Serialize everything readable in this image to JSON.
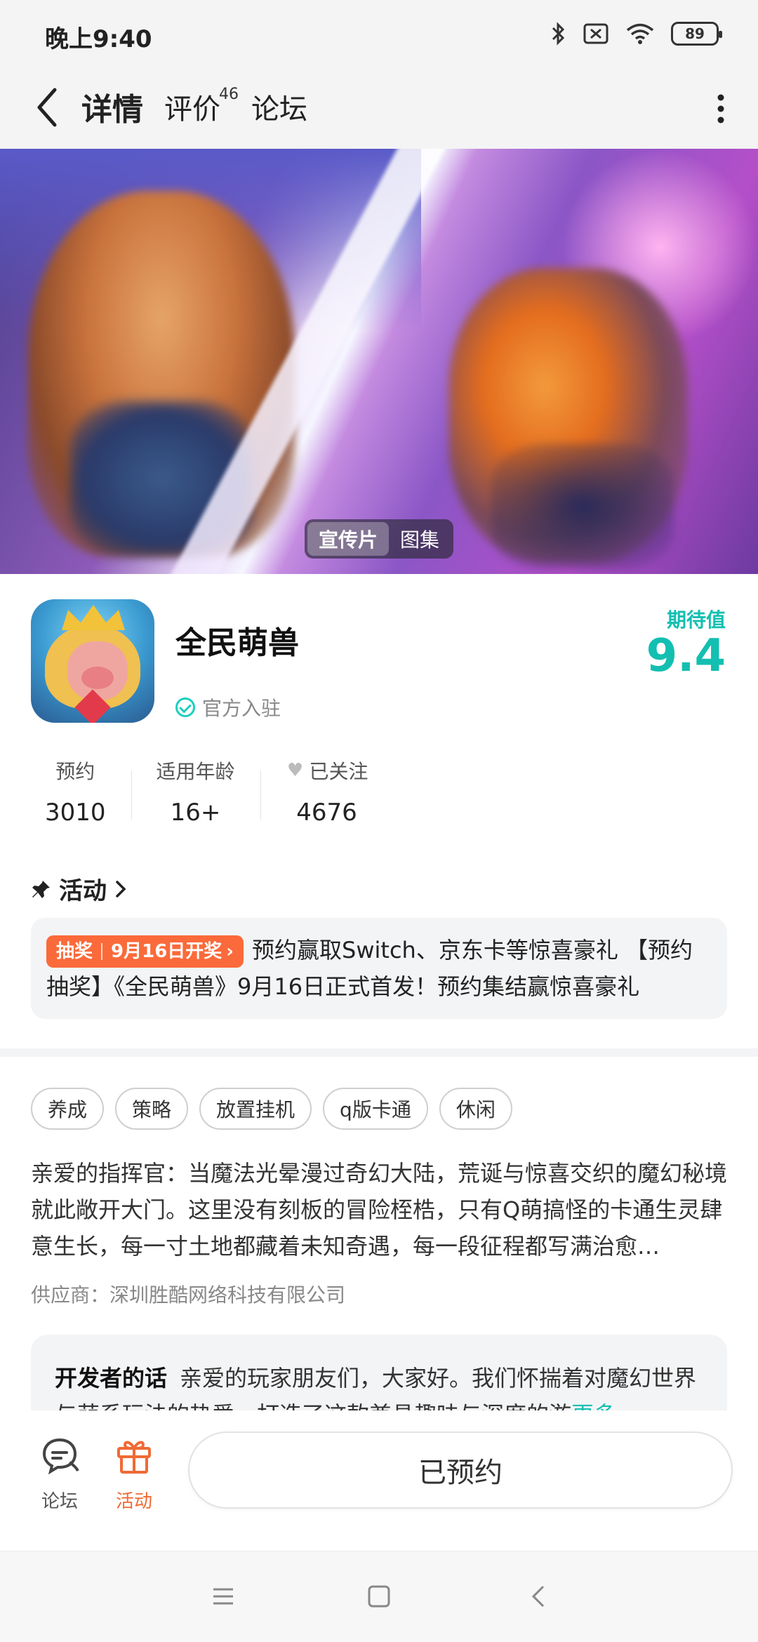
{
  "status_bar": {
    "time": "晚上9:40",
    "battery": "89"
  },
  "header": {
    "tabs": [
      {
        "label": "详情",
        "active": true
      },
      {
        "label": "评价",
        "count": "46"
      },
      {
        "label": "论坛"
      }
    ]
  },
  "banner": {
    "segments": [
      "宣传片",
      "图集"
    ],
    "selected": "宣传片"
  },
  "app": {
    "name": "全民萌兽",
    "official_label": "官方入驻",
    "expect_label": "期待值",
    "expect_score": "9.4"
  },
  "stats": [
    {
      "label": "预约",
      "value": "3010"
    },
    {
      "label": "适用年龄",
      "value": "16+"
    },
    {
      "label": "已关注",
      "value": "4676"
    }
  ],
  "activity": {
    "title": "活动",
    "badge_type": "抽奖",
    "badge_date": "9月16日开奖",
    "text": "预约赢取Switch、京东卡等惊喜豪礼 【预约抽奖】《全民萌兽》9月16日正式首发！预约集结赢惊喜豪礼"
  },
  "tags": [
    "养成",
    "策略",
    "放置挂机",
    "q版卡通",
    "休闲"
  ],
  "description": "亲爱的指挥官：当魔法光晕漫过奇幻大陆，荒诞与惊喜交织的魔幻秘境就此敞开大门。这里没有刻板的冒险桎梏，只有Q萌搞怪的卡通生灵肆意生长，每一寸土地都藏着未知奇遇，每一段征程都写满治愈…",
  "supplier": "供应商：深圳胜酷网络科技有限公司",
  "developer": {
    "title": "开发者的话",
    "text": "亲爱的玩家朋友们，大家好。我们怀揣着对魔幻世界与萌系玩法的热爱，打造了这款兼具趣味与深度的游",
    "more": "更多"
  },
  "bottom_bar": {
    "forum_label": "论坛",
    "activity_label": "活动",
    "reserve_label": "已预约"
  },
  "colors": {
    "accent": "#13bfb1",
    "orange": "#fb6a3a"
  }
}
